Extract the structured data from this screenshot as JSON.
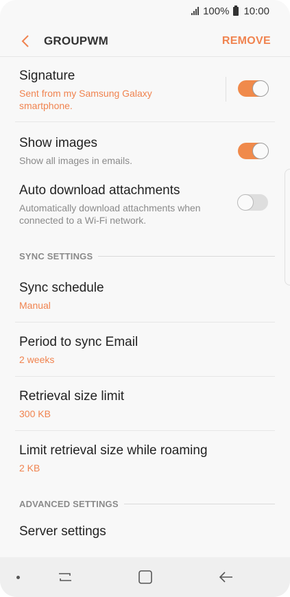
{
  "status": {
    "signal": "signal-icon",
    "battery_pct": "100%",
    "time": "10:00"
  },
  "appbar": {
    "title": "GROUPWM",
    "remove_label": "REMOVE"
  },
  "settings": {
    "signature": {
      "label": "Signature",
      "value": "Sent from my Samsung Galaxy smartphone.",
      "enabled": true
    },
    "show_images": {
      "label": "Show images",
      "desc": "Show all images in emails.",
      "enabled": true
    },
    "auto_download": {
      "label": "Auto download attachments",
      "desc": "Automatically download attachments when connected to a Wi-Fi network.",
      "enabled": false
    },
    "sync_section": "SYNC SETTINGS",
    "sync_schedule": {
      "label": "Sync schedule",
      "value": "Manual"
    },
    "period_sync": {
      "label": "Period to sync Email",
      "value": "2 weeks"
    },
    "retrieval_limit": {
      "label": "Retrieval size limit",
      "value": "300 KB"
    },
    "retrieval_roaming": {
      "label": "Limit retrieval size while roaming",
      "value": "2 KB"
    },
    "advanced_section": "ADVANCED SETTINGS",
    "server_settings": {
      "label": "Server settings"
    }
  },
  "colors": {
    "accent": "#f0834f",
    "toggle_on": "#f08a4b",
    "toggle_off": "#dedede"
  }
}
